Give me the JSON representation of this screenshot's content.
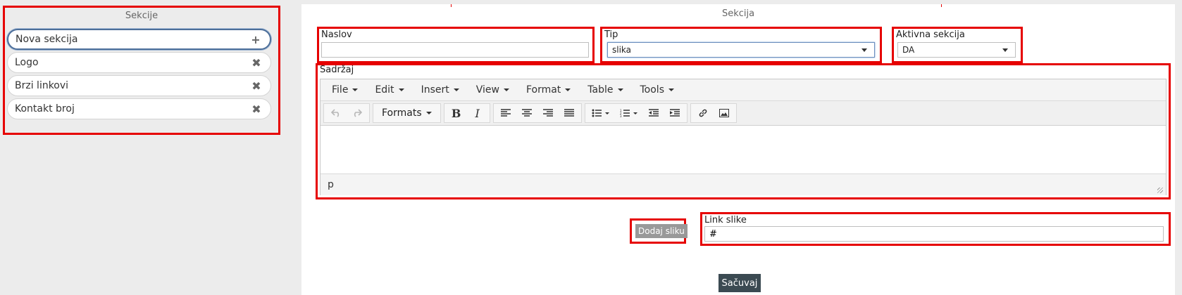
{
  "sidebar": {
    "title": "Sekcije",
    "items": [
      {
        "label": "Nova sekcija",
        "action": "+"
      },
      {
        "label": "Logo",
        "action": "✖"
      },
      {
        "label": "Brzi linkovi",
        "action": "✖"
      },
      {
        "label": "Kontakt broj",
        "action": "✖"
      }
    ]
  },
  "main": {
    "title": "Sekcija",
    "naslov": {
      "label": "Naslov",
      "value": ""
    },
    "tip": {
      "label": "Tip",
      "value": "slika"
    },
    "aktivna": {
      "label": "Aktivna sekcija",
      "value": "DA"
    },
    "sadrzaj": {
      "label": "Sadržaj",
      "menu": [
        "File",
        "Edit",
        "Insert",
        "View",
        "Format",
        "Table",
        "Tools"
      ],
      "formats_label": "Formats",
      "status": "p"
    },
    "dodaj_slike": "Dodaj sliku",
    "link_slike": {
      "label": "Link slike",
      "value": "#"
    },
    "save_label": "Sačuvaj"
  },
  "colors": {
    "highlight": "#e60000",
    "save_bg": "#3b4a52",
    "active_border": "#4d6f9a"
  }
}
